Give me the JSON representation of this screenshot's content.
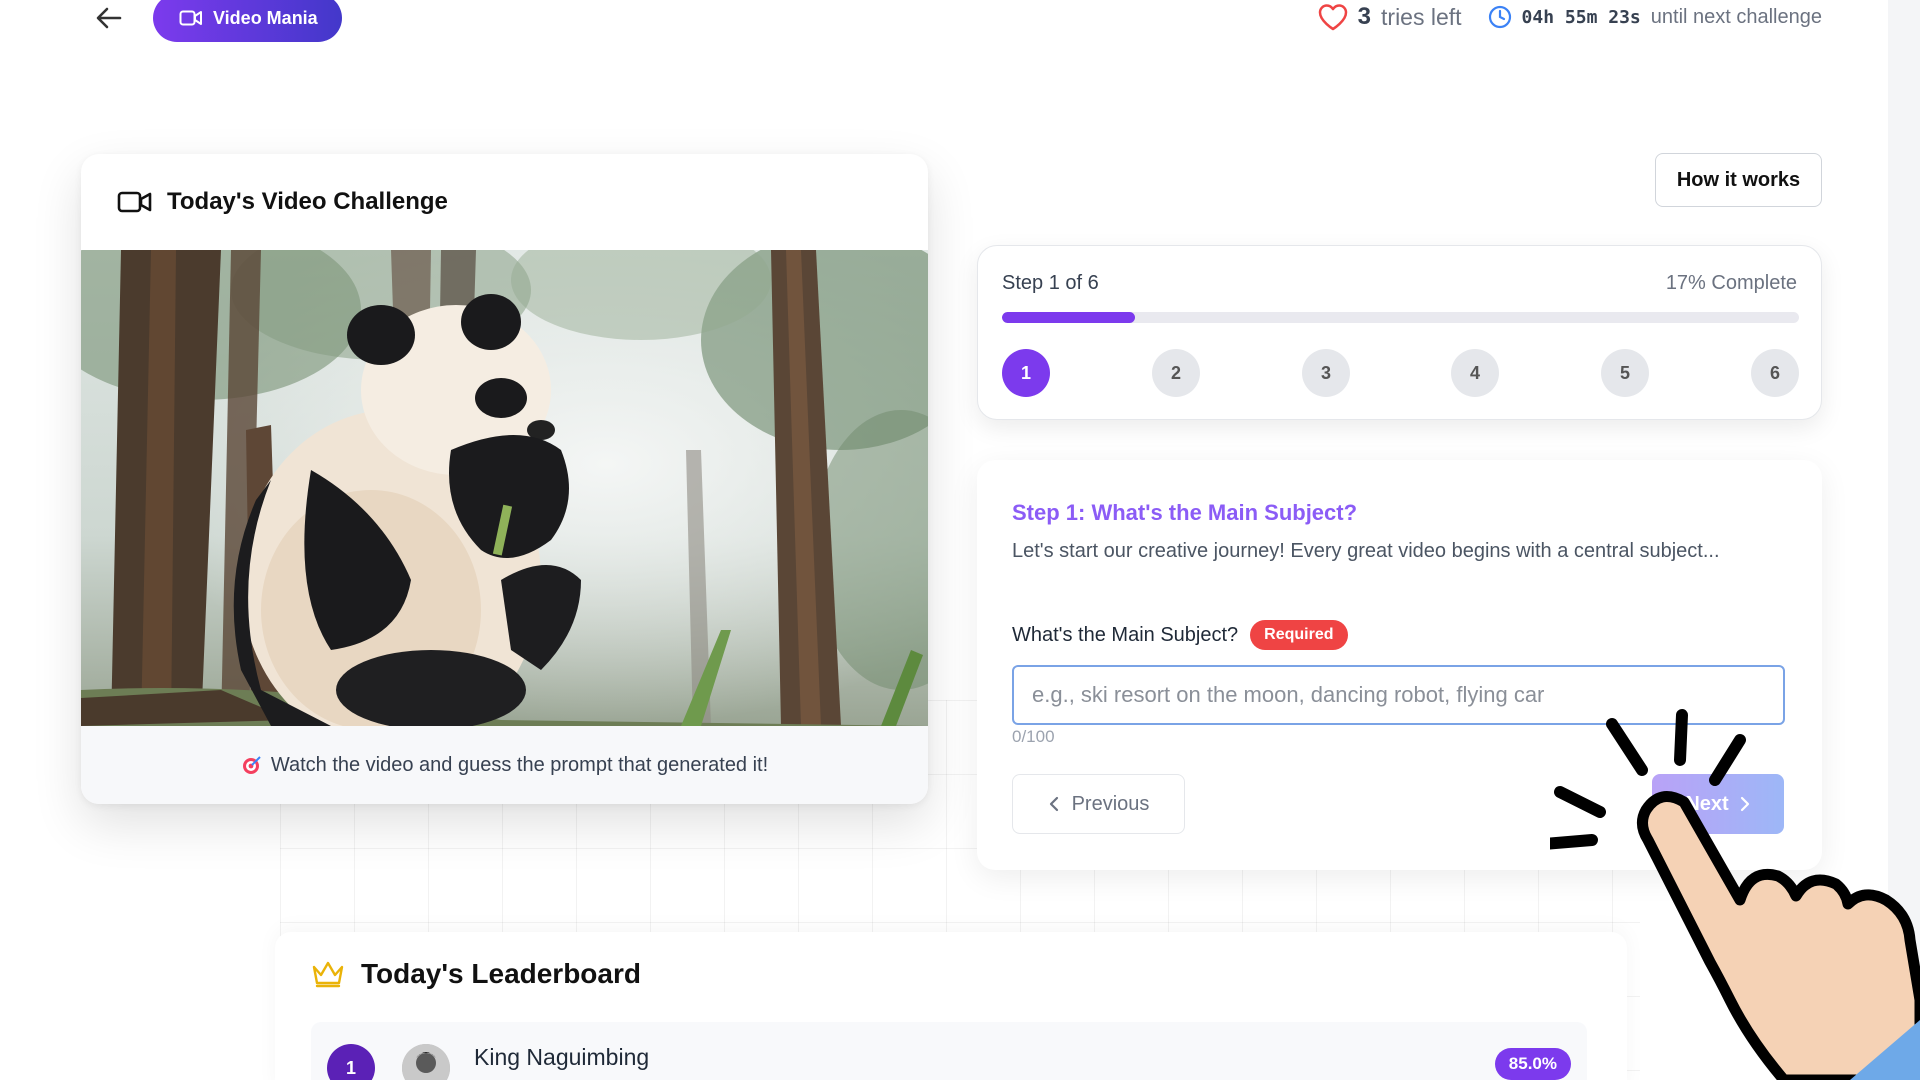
{
  "header": {
    "brand_label": "Video Mania",
    "tries_count": "3",
    "tries_label": "tries left",
    "timer": "04h 55m 23s",
    "timer_suffix": "until next challenge"
  },
  "video_card": {
    "title": "Today's Video Challenge",
    "footer_text": "Watch the video and guess the prompt that generated it!"
  },
  "how_it_works_label": "How it works",
  "progress": {
    "step_text": "Step 1 of 6",
    "percent_text": "17% Complete",
    "fraction": 0.167,
    "steps": [
      "1",
      "2",
      "3",
      "4",
      "5",
      "6"
    ],
    "active_step": 1
  },
  "question": {
    "title": "Step 1: What's the Main Subject?",
    "description": "Let's start our creative journey! Every great video begins with a central subject...",
    "label": "What's the Main Subject?",
    "required_badge": "Required",
    "placeholder": "e.g., ski resort on the moon, dancing robot, flying car",
    "value": "",
    "counter": "0/100",
    "previous_label": "Previous",
    "next_label": "Next"
  },
  "leaderboard": {
    "title": "Today's Leaderboard",
    "rows": [
      {
        "rank": "1",
        "name": "King Naguimbing",
        "score": "85.0%"
      }
    ]
  },
  "colors": {
    "accent": "#7c3aed",
    "required": "#ef4444",
    "progress_track": "#e9e9ef"
  }
}
